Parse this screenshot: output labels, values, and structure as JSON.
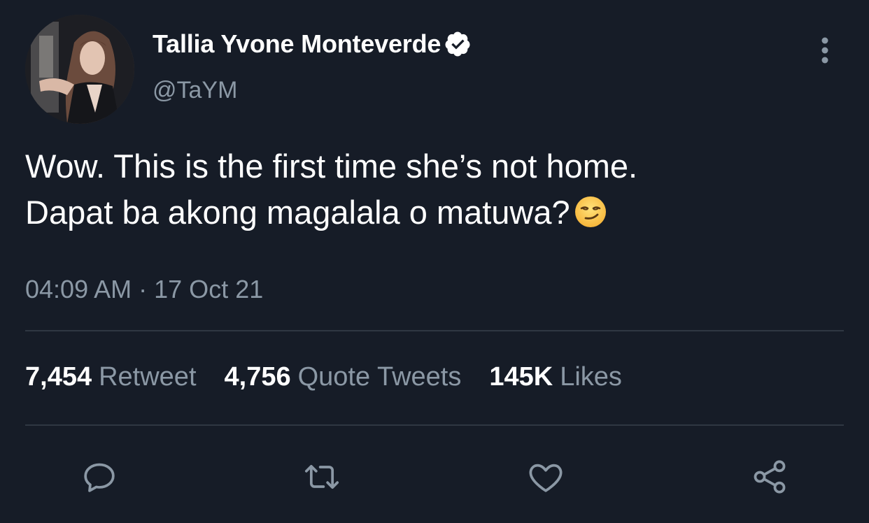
{
  "user": {
    "display_name": "Tallia Yvone Monteverde",
    "handle": "@TaYM",
    "verified": true
  },
  "tweet": {
    "line1": "Wow. This is the first time she’s not home.",
    "line2": "Dapat ba akong magalala o matuwa?",
    "emoji": "smirking-face",
    "time": "04:09 AM",
    "separator": "·",
    "date": "17 Oct 21"
  },
  "stats": {
    "retweets_count": "7,454",
    "retweets_label": "Retweet",
    "quotes_count": "4,756",
    "quotes_label": "Quote Tweets",
    "likes_count": "145K",
    "likes_label": "Likes"
  },
  "colors": {
    "background": "#161c27",
    "secondary_text": "#8b98a5",
    "divider": "#2f3742",
    "icon": "#8b98a5"
  },
  "icons": [
    "more-vertical-icon",
    "verified-badge-icon",
    "reply-icon",
    "retweet-icon",
    "like-icon",
    "share-icon"
  ]
}
